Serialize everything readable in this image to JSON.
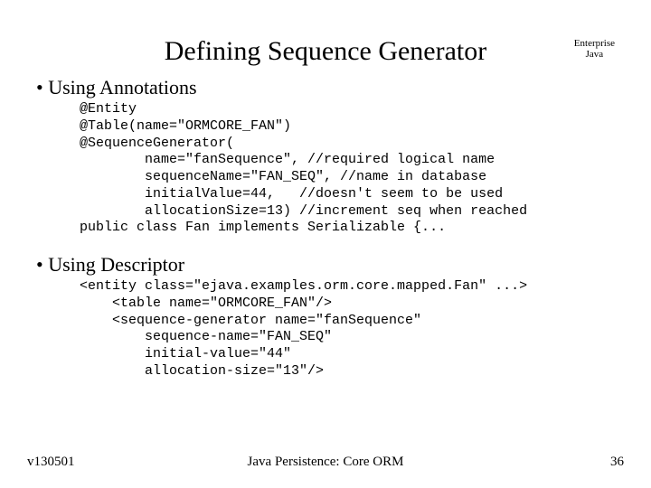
{
  "header": {
    "title": "Defining Sequence Generator",
    "corner_line1": "Enterprise",
    "corner_line2": "Java"
  },
  "sections": {
    "bullet1": "Using Annotations",
    "code1": "@Entity\n@Table(name=\"ORMCORE_FAN\")\n@SequenceGenerator(\n        name=\"fanSequence\", //required logical name\n        sequenceName=\"FAN_SEQ\", //name in database\n        initialValue=44,   //doesn't seem to be used\n        allocationSize=13) //increment seq when reached\npublic class Fan implements Serializable {...",
    "bullet2": "Using Descriptor",
    "code2": "<entity class=\"ejava.examples.orm.core.mapped.Fan\" ...>\n    <table name=\"ORMCORE_FAN\"/>\n    <sequence-generator name=\"fanSequence\"\n        sequence-name=\"FAN_SEQ\"\n        initial-value=\"44\"\n        allocation-size=\"13\"/>"
  },
  "footer": {
    "left": "v130501",
    "center": "Java Persistence: Core ORM",
    "right": "36"
  }
}
